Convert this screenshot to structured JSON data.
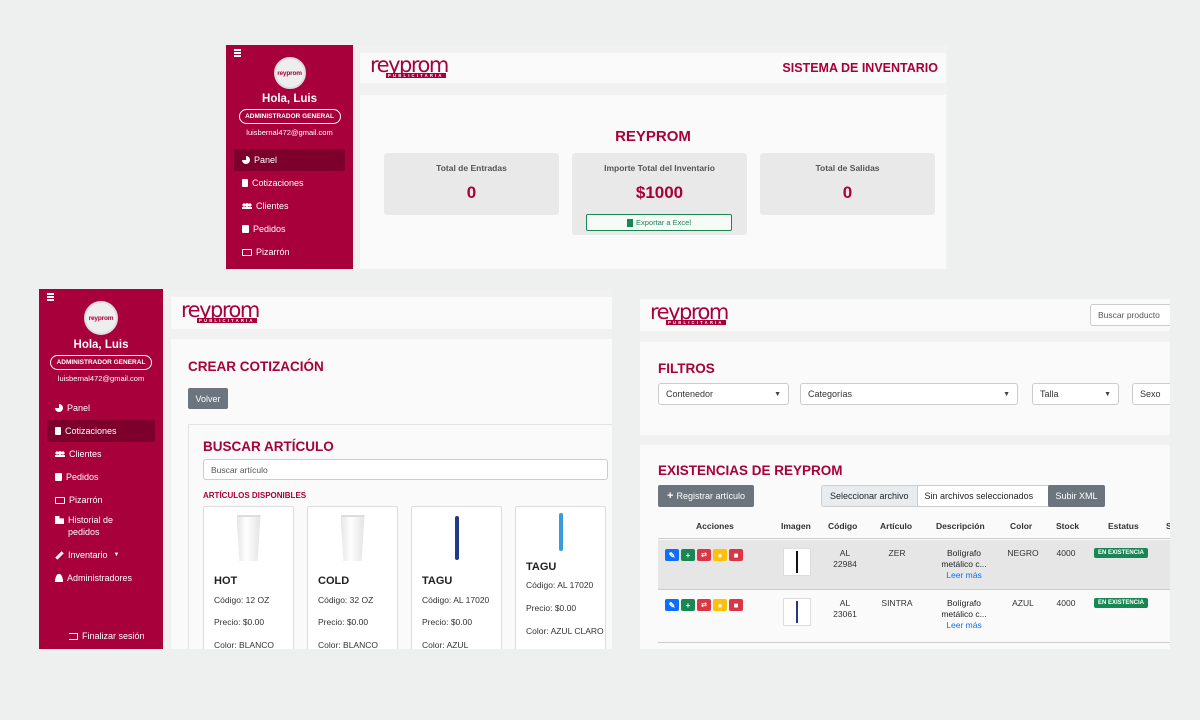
{
  "brand": {
    "logo_text": "reyprom",
    "logo_sub": "PUBLICITARIA"
  },
  "user": {
    "greeting": "Hola, Luis",
    "role": "ADMINISTRADOR GENERAL",
    "email": "luisbernal472@gmail.com",
    "avatar_text": "reyprom"
  },
  "nav": {
    "panel": "Panel",
    "cotizaciones": "Cotizaciones",
    "clientes": "Clientes",
    "pedidos": "Pedidos",
    "pizarron": "Pizarrón",
    "historial": "Historial de pedidos",
    "inventario": "Inventario",
    "administradores": "Administradores",
    "logout": "Finalizar sesión"
  },
  "dashboard": {
    "system_title": "SISTEMA DE INVENTARIO",
    "heading": "REYPROM",
    "stats": [
      {
        "label": "Total de Entradas",
        "value": "0"
      },
      {
        "label": "Importe Total del Inventario",
        "value": "$1000"
      },
      {
        "label": "Total de Salidas",
        "value": "0"
      }
    ],
    "export_label": "Exportar a Excel"
  },
  "quote": {
    "title": "CREAR COTIZACIÓN",
    "back_label": "Volver",
    "search_title": "BUSCAR ARTÍCULO",
    "search_placeholder": "Buscar artículo",
    "available_label": "ARTÍCULOS DISPONIBLES",
    "products": [
      {
        "name": "HOT",
        "code": "Código: 12 OZ",
        "price": "Precio: $0.00",
        "color": "Color: BLANCO"
      },
      {
        "name": "COLD",
        "code": "Código: 32 OZ",
        "price": "Precio: $0.00",
        "color": "Color: BLANCO"
      },
      {
        "name": "TAGU",
        "code": "Código: AL 17020",
        "price": "Precio: $0.00",
        "color": "Color: AZUL"
      },
      {
        "name": "TAGU",
        "code": "Código: AL 17020",
        "price": "Precio: $0.00",
        "color": "Color: AZUL CLARO"
      }
    ]
  },
  "inventory": {
    "search_placeholder": "Buscar producto",
    "filters_title": "FILTROS",
    "filters": [
      "Contenedor",
      "Categorías",
      "Talla",
      "Sexo"
    ],
    "stock_title": "EXISTENCIAS DE REYPROM",
    "register_label": "Registrar artículo",
    "file_button": "Seleccionar archivo",
    "file_status": "Sin archivos seleccionados",
    "upload_label": "Subir XML",
    "columns": [
      "Acciones",
      "Imagen",
      "Código",
      "Artículo",
      "Descripción",
      "Color",
      "Stock",
      "Estatus",
      "S"
    ],
    "rows": [
      {
        "code": "AL 22984",
        "article": "ZER",
        "desc": "Bolígrafo metálico c...",
        "more": "Leer más",
        "color": "NEGRO",
        "stock": "4000",
        "status": "EN EXISTENCIA"
      },
      {
        "code": "AL 23061",
        "article": "SINTRA",
        "desc": "Bolígrafo metálico c...",
        "more": "Leer más",
        "color": "AZUL",
        "stock": "4000",
        "status": "EN EXISTENCIA"
      }
    ]
  },
  "colors": {
    "brand": "#a7003b",
    "brand_dark": "#7c002b",
    "success": "#198754",
    "action_blue": "#0d6efd",
    "action_green": "#198754",
    "action_red": "#dc3545",
    "action_yellow": "#ffc107"
  }
}
